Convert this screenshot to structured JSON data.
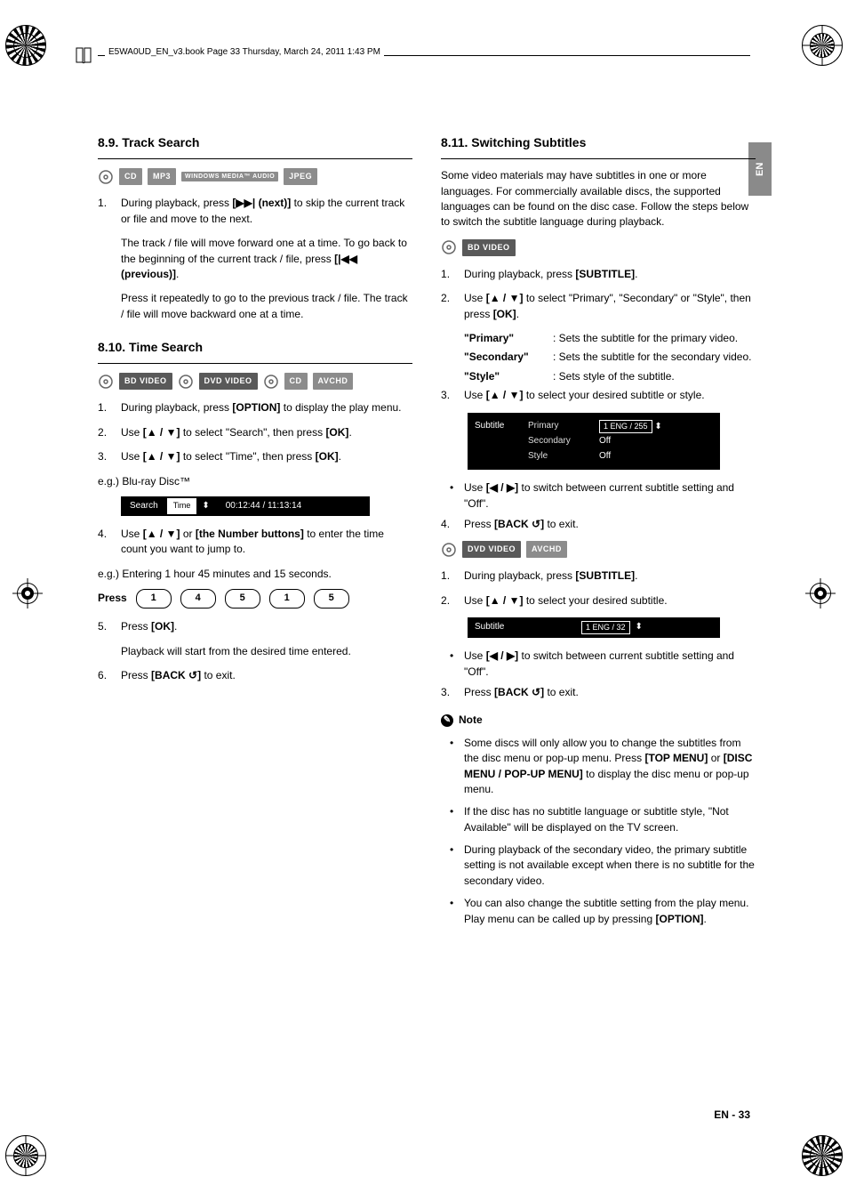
{
  "header": {
    "running": "E5WA0UD_EN_v3.book  Page 33  Thursday, March 24, 2011  1:43 PM"
  },
  "side_tab": "EN",
  "footer": {
    "lang": "EN",
    "page": "33"
  },
  "badges": {
    "cd": "CD",
    "mp3": "MP3",
    "wma": "WINDOWS MEDIA™ AUDIO",
    "jpeg": "JPEG",
    "bd": "BD VIDEO",
    "dvd": "DVD VIDEO",
    "avchd": "AVCHD"
  },
  "s89": {
    "title": "8.9.  Track Search",
    "step1": {
      "a": "During playback, press",
      "next": "(next)",
      "b": "to skip the current track or file and move to the next.",
      "c": "The track / file will move forward one at a time. To go back to the beginning of the current track / file, press",
      "prev": "(previous)",
      "d": "Press it repeatedly to go to the previous track / file. The track / file will move backward one at a time."
    }
  },
  "s810": {
    "title": "8.10.  Time Search",
    "step1": {
      "a": "During playback, press",
      "key": "[OPTION]",
      "b": "to display the play menu."
    },
    "step2": {
      "a": "Use",
      "b": "to select \"Search\", then press",
      "key": "[OK]"
    },
    "step3": {
      "a": "Use",
      "b": "to select \"Time\", then press",
      "key": "[OK]"
    },
    "eg1": "e.g.) Blu-ray Disc™",
    "osd": {
      "search": "Search",
      "time_label": "Time",
      "time_value": "00:12:44 / 11:13:14"
    },
    "step4": {
      "a": "Use",
      "or": "or",
      "key": "[the Number buttons]",
      "b": "to enter the time count you want to jump to."
    },
    "eg2": "e.g.) Entering 1 hour 45 minutes and 15 seconds.",
    "press": "Press",
    "digits": [
      "1",
      "4",
      "5",
      "1",
      "5"
    ],
    "step5": {
      "a": "Press",
      "key": "[OK]",
      "b": "Playback will start from the desired time entered."
    },
    "step6": {
      "a": "Press",
      "b": "to exit."
    }
  },
  "s811": {
    "title": "8.11.  Switching Subtitles",
    "intro": "Some video materials may have subtitles in one or more languages. For commercially available discs, the supported languages can be found on the disc case. Follow the steps below to switch the subtitle language during playback.",
    "a": {
      "step1": {
        "a": "During playback, press",
        "key": "[SUBTITLE]"
      },
      "step2": {
        "a": "Use",
        "b": "to select \"Primary\", \"Secondary\" or \"Style\", then press",
        "key": "[OK]"
      },
      "step3": {
        "a": "Use",
        "b": "to select your desired subtitle or style."
      },
      "bullet": {
        "a": "Use",
        "b": "to switch between current subtitle setting and \"Off\"."
      },
      "step4": {
        "a": "Press",
        "b": "to exit."
      }
    },
    "defs": {
      "primary": {
        "term": "\"Primary\"",
        "desc": ": Sets the subtitle for the primary video."
      },
      "secondary": {
        "term": "\"Secondary\"",
        "desc": ": Sets the subtitle for the secondary video."
      },
      "style": {
        "term": "\"Style\"",
        "desc": ": Sets style of the subtitle."
      }
    },
    "osd1": {
      "col": "Subtitle",
      "r1": {
        "label": "Primary",
        "val": "1  ENG / 255"
      },
      "r2": {
        "label": "Secondary",
        "val": "Off"
      },
      "r3": {
        "label": "Style",
        "val": "Off"
      }
    },
    "b": {
      "step1": {
        "a": "During playback, press",
        "key": "[SUBTITLE]"
      },
      "step2": {
        "a": "Use",
        "b": "to select your desired subtitle."
      },
      "bullet": {
        "a": "Use",
        "b": "to switch between current subtitle setting and \"Off\"."
      },
      "step3": {
        "a": "Press",
        "b": "to exit."
      }
    },
    "osd2": {
      "label": "Subtitle",
      "val": "1 ENG / 32"
    },
    "note": {
      "title": "Note",
      "items": [
        {
          "a": "Some discs will only allow you to change the subtitles from the disc menu or pop-up menu. Press",
          "k1": "[TOP MENU]",
          "or": "or",
          "k2": "[DISC MENU / POP-UP MENU]",
          "b": "to display the disc menu or pop-up menu."
        },
        {
          "a": "If the disc has no subtitle language or subtitle style, \"Not Available\" will be displayed on the TV screen."
        },
        {
          "a": "During playback of the secondary video, the primary subtitle setting is not available except when there is no subtitle for the secondary video."
        },
        {
          "a": "You can also change the subtitle setting from the play menu. Play menu can be called up by pressing",
          "k": "[OPTION]"
        }
      ]
    }
  }
}
